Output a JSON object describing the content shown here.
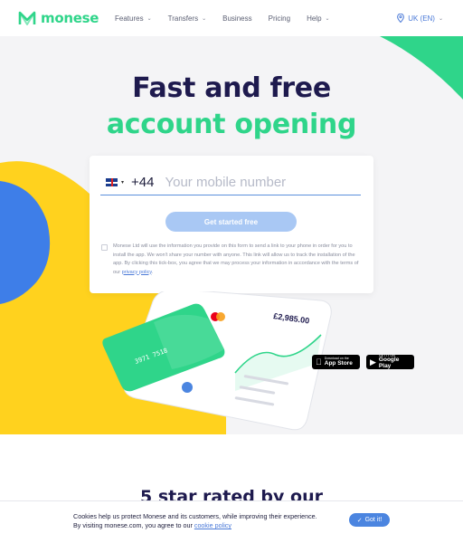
{
  "brand": {
    "name": "monese",
    "color": "#2fd58a"
  },
  "nav": {
    "items": [
      {
        "label": "Features",
        "has_dropdown": true
      },
      {
        "label": "Transfers",
        "has_dropdown": true
      },
      {
        "label": "Business",
        "has_dropdown": false
      },
      {
        "label": "Pricing",
        "has_dropdown": false
      },
      {
        "label": "Help",
        "has_dropdown": true
      }
    ],
    "language": "UK (EN)"
  },
  "hero": {
    "title_line1": "Fast and free",
    "title_line2": "account opening"
  },
  "signup": {
    "country_prefix": "+44",
    "phone_placeholder": "Your mobile number",
    "button_label": "Get started free",
    "consent_text": "Monese Ltd will use the information you provide on this form to send a link to your phone in order for you to install the app. We won't share your number with anyone. This link will allow us to track the installation of the app. By clicking this tick-box, you agree that we may process your information in accordance with the terms of our ",
    "consent_link": "privacy policy",
    "consent_end": "."
  },
  "mockup": {
    "balance": "£2,985.00",
    "card_number": "3971 7518"
  },
  "stores": {
    "apple_small": "Download on the",
    "apple_big": "App Store",
    "google_small": "GET IT ON",
    "google_big": "Google Play"
  },
  "section": {
    "title": "5 star rated by our"
  },
  "cookie": {
    "text": "Cookies help us protect Monese and its customers, while improving their experience. By visiting monese.com, you agree to our ",
    "link": "cookie policy",
    "button_label": "Got it!"
  },
  "colors": {
    "accent_green": "#2fd58a",
    "accent_blue": "#4b85e0",
    "yellow": "#ffd21e",
    "navy": "#1e1a4e"
  }
}
